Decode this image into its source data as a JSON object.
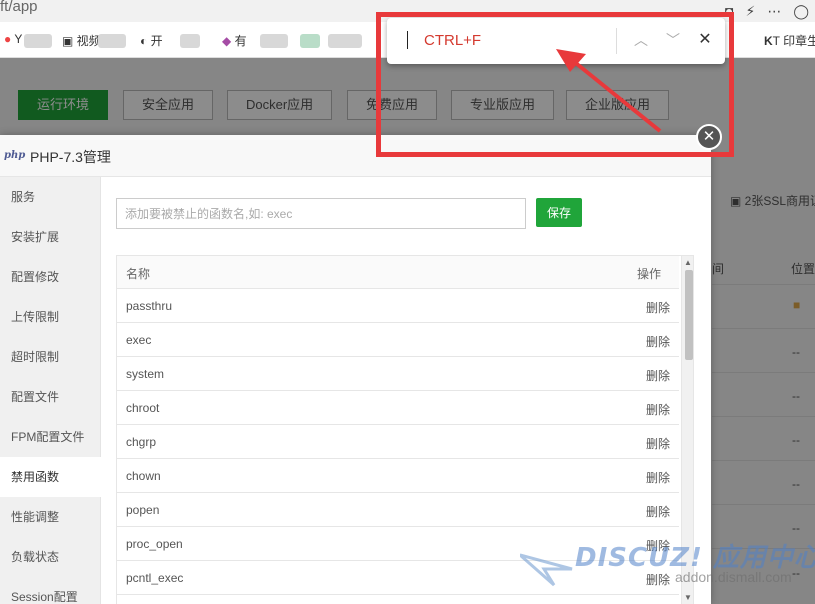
{
  "browser": {
    "url_text": "ft/app",
    "toolbar_icons": [
      "camera-icon",
      "bolt-icon",
      "more-icon",
      "profile-icon"
    ],
    "toolbar_glyphs": [
      "◘",
      "⚡",
      "⋯",
      "◯"
    ],
    "bookmarks": [
      {
        "label": "Y"
      },
      {
        "label": "视频"
      },
      {
        "label": "开"
      },
      {
        "label": "有"
      },
      {
        "label": "T 印章生"
      }
    ]
  },
  "top_tabs": [
    {
      "label": "运行环境",
      "active": true
    },
    {
      "label": "安全应用",
      "active": false
    },
    {
      "label": "Docker应用",
      "active": false
    },
    {
      "label": "免费应用",
      "active": false
    },
    {
      "label": "专业版应用",
      "active": false
    },
    {
      "label": "企业版应用",
      "active": false
    }
  ],
  "background_page": {
    "ssl_promo": "2张SSL商用证书",
    "col_1": "间",
    "col_2": "位置",
    "dash": "--"
  },
  "modal": {
    "logo": "php",
    "title": "PHP-7.3管理",
    "sidebar": [
      {
        "label": "服务",
        "active": false
      },
      {
        "label": "安装扩展",
        "active": false
      },
      {
        "label": "配置修改",
        "active": false
      },
      {
        "label": "上传限制",
        "active": false
      },
      {
        "label": "超时限制",
        "active": false
      },
      {
        "label": "配置文件",
        "active": false
      },
      {
        "label": "FPM配置文件",
        "active": false
      },
      {
        "label": "禁用函数",
        "active": true
      },
      {
        "label": "性能调整",
        "active": false
      },
      {
        "label": "负载状态",
        "active": false
      },
      {
        "label": "Session配置",
        "active": false
      }
    ],
    "input_placeholder": "添加要被禁止的函数名,如: exec",
    "save_label": "保存",
    "table": {
      "col_name": "名称",
      "col_action": "操作",
      "delete_label": "删除",
      "rows": [
        "passthru",
        "exec",
        "system",
        "chroot",
        "chgrp",
        "chown",
        "popen",
        "proc_open",
        "pcntl_exec"
      ]
    }
  },
  "find_bar": {
    "query": "CTRL+F",
    "prev_glyph": "︿",
    "next_glyph": "﹀",
    "close_glyph": "✕"
  },
  "overlay_close_glyph": "✕",
  "watermark": {
    "main": "DISCUZ! 应用中心",
    "sub": "addon.dismall.com"
  },
  "colors": {
    "accent_green": "#20a53a",
    "annotation_red": "#e8393b",
    "find_text_red": "#d43a2f"
  }
}
